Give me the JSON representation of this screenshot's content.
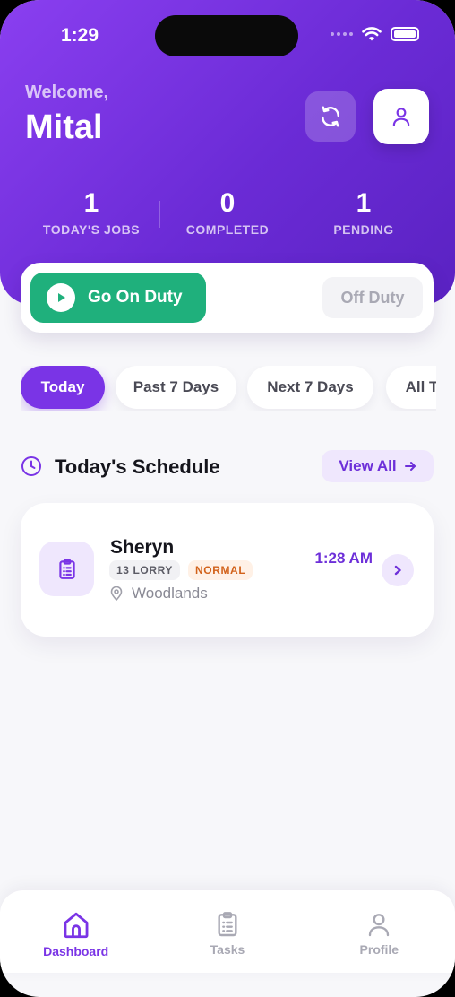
{
  "status_bar": {
    "time": "1:29"
  },
  "header": {
    "greeting": "Welcome,",
    "user_name": "Mital",
    "stats": [
      {
        "value": "1",
        "label": "TODAY'S JOBS"
      },
      {
        "value": "0",
        "label": "COMPLETED"
      },
      {
        "value": "1",
        "label": "PENDING"
      }
    ]
  },
  "duty": {
    "go_on_label": "Go On Duty",
    "off_label": "Off Duty"
  },
  "filters": [
    {
      "label": "Today",
      "active": true
    },
    {
      "label": "Past 7 Days",
      "active": false
    },
    {
      "label": "Next 7 Days",
      "active": false
    },
    {
      "label": "All T",
      "active": false
    }
  ],
  "schedule": {
    "title": "Today's Schedule",
    "view_all_label": "View All",
    "jobs": [
      {
        "name": "Sheryn",
        "vehicle": "13 LORRY",
        "priority": "NORMAL",
        "location": "Woodlands",
        "time": "1:28 AM"
      }
    ]
  },
  "bottom_nav": [
    {
      "label": "Dashboard",
      "icon": "home-icon",
      "active": true
    },
    {
      "label": "Tasks",
      "icon": "clipboard-icon",
      "active": false
    },
    {
      "label": "Profile",
      "icon": "user-icon",
      "active": false
    }
  ],
  "colors": {
    "primary": "#7a34e6",
    "header_gradient_start": "#8a3ff0",
    "header_gradient_end": "#5a22c2",
    "success": "#1fb07c",
    "priority_normal": "#d2621a"
  }
}
